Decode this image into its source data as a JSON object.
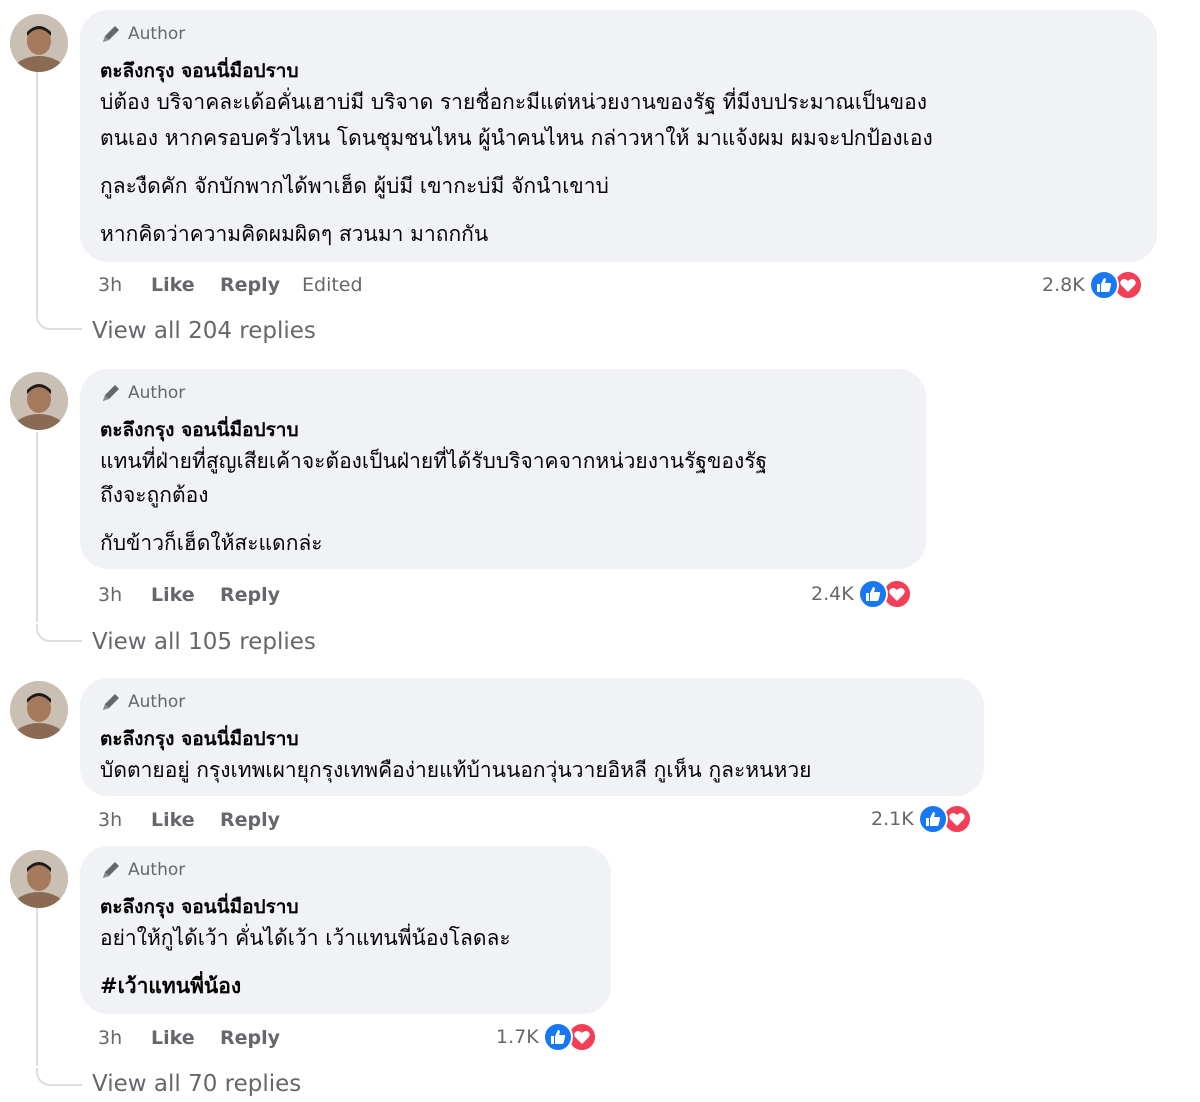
{
  "comments": [
    {
      "author_tag": "Author",
      "name": "ตะลึงกรุง จอนนี่มือปราบ",
      "lines": [
        "บ่ต้อง บริจาคละเด้อคั่นเฮาบ่มี บริจาด รายชื่อกะมีแต่หน่วยงานของรัฐ ที่มีงบประมาณเป็นของ",
        "ตนเอง หากครอบครัวไหน โดนชุมชนไหน ผู้นำคนไหน กล่าวหาให้ มาแจ้งผม ผมจะปกป้องเอง",
        "กูละงืดคัก จักบักพากได้พาเฮ็ด ผู้บ่มี เขากะบ่มี จักนำเขาบ่",
        "หากคิดว่าความคิดผมผิดๆ สวนมา มาถกกัน"
      ],
      "time": "3h",
      "like_label": "Like",
      "reply_label": "Reply",
      "edited_label": "Edited",
      "reaction_count": "2.8K",
      "view_replies": "View all 204 replies"
    },
    {
      "author_tag": "Author",
      "name": "ตะลึงกรุง จอนนี่มือปราบ",
      "lines": [
        "แทนที่ฝ่ายที่สูญเสียเค้าจะต้องเป็นฝ่ายที่ได้รับบริจาคจากหน่วยงานรัฐของรัฐ",
        "ถึงจะถูกต้อง",
        "กับข้าวก็เฮ็ดให้สะแดกล่ะ"
      ],
      "time": "3h",
      "like_label": "Like",
      "reply_label": "Reply",
      "reaction_count": "2.4K",
      "view_replies": "View all 105 replies"
    },
    {
      "author_tag": "Author",
      "name": "ตะลึงกรุง จอนนี่มือปราบ",
      "lines": [
        "บัดตายอยู่ กรุงเทพเผายุกรุงเทพคือง่ายแท้บ้านนอกวุ่นวายอิหลี กูเห็น กูละหนหวย"
      ],
      "time": "3h",
      "like_label": "Like",
      "reply_label": "Reply",
      "reaction_count": "2.1K"
    },
    {
      "author_tag": "Author",
      "name": "ตะลึงกรุง จอนนี่มือปราบ",
      "lines": [
        "อย่าให้กูได้เว้า คั่นได้เว้า เว้าแทนพี่น้องโลดละ",
        "#เว้าแทนพี่น้อง"
      ],
      "time": "3h",
      "like_label": "Like",
      "reply_label": "Reply",
      "reaction_count": "1.7K",
      "view_replies": "View all 70 replies"
    }
  ],
  "colors": {
    "bubble_bg": "#f0f2f5",
    "meta_text": "#65676b",
    "like_blue": "#1877f2",
    "love_red": "#f33e58"
  },
  "icons": [
    "avatar-photo",
    "pen-icon",
    "like-reaction-icon",
    "love-reaction-icon"
  ]
}
